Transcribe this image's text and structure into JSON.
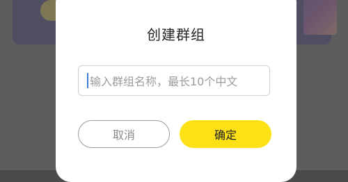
{
  "dialog": {
    "title": "创建群组",
    "input": {
      "value": "",
      "placeholder": "输入群组名称，最长10个中文"
    },
    "cancel_label": "取消",
    "confirm_label": "确定"
  },
  "colors": {
    "accent": "#fde016",
    "overlay": "#6e6e6e"
  }
}
